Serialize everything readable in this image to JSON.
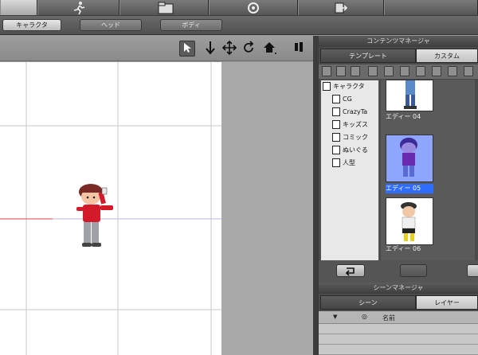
{
  "subtabs": {
    "character": "キャラクタ",
    "head": "ヘッド",
    "body": "ボディ"
  },
  "content_manager": {
    "title": "コンテンツマネージャ",
    "tab_template": "テンプレート",
    "tab_custom": "カスタム",
    "tree": [
      {
        "label": "キャラクタ"
      },
      {
        "label": "CG"
      },
      {
        "label": "CrazyTa"
      },
      {
        "label": "キッズス"
      },
      {
        "label": "コミック"
      },
      {
        "label": "ぬいぐる"
      },
      {
        "label": "人型"
      }
    ],
    "thumbs": [
      {
        "label": "エディー 04"
      },
      {
        "label": "エディー 05"
      },
      {
        "label": "エディー 06"
      }
    ]
  },
  "scene_manager": {
    "title": "シーンマネージャ",
    "tab_scene": "シーン",
    "tab_layer": "レイヤー",
    "col_name": "名前"
  },
  "colors": {
    "selection": "#2f6cff",
    "grid_line": "#c8c8d0",
    "axis_red": "#e04040"
  }
}
